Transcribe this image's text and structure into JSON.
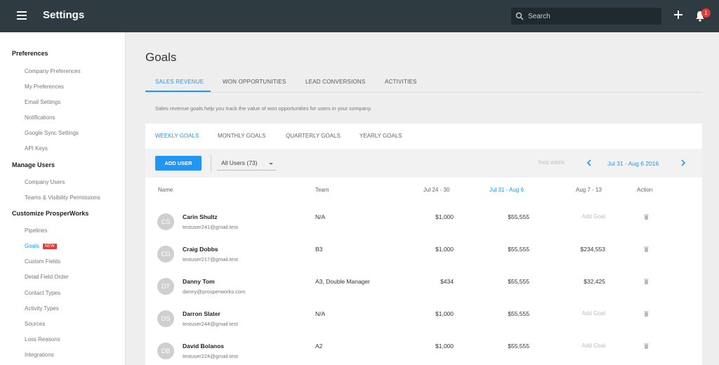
{
  "app": {
    "title": "Settings"
  },
  "search": {
    "placeholder": "Search"
  },
  "notifications": {
    "count": "1"
  },
  "sidebar": {
    "sections": [
      {
        "title": "Preferences",
        "items": [
          "Company Preferences",
          "My Preferences",
          "Email Settings",
          "Notifications",
          "Google Sync Settings",
          "API Keys"
        ]
      },
      {
        "title": "Manage Users",
        "items": [
          "Company Users",
          "Teams & Visibility Permissions"
        ]
      },
      {
        "title": "Customize ProsperWorks",
        "items": [
          "Pipelines",
          "Goals",
          "Custom Fields",
          "Detail Field Order",
          "Contact Types",
          "Activity Types",
          "Sources",
          "Loss Reasons",
          "Integrations"
        ]
      }
    ],
    "active_item": "Goals",
    "new_badge": "NEW"
  },
  "page": {
    "title": "Goals",
    "tabs": [
      "SALES REVENUE",
      "WON OPPORTUNITIES",
      "LEAD CONVERSIONS",
      "ACTIVITIES"
    ],
    "active_tab": "SALES REVENUE",
    "description": "Sales revenue goals help you track the value of won opportunities for users in your company."
  },
  "goals": {
    "period_tabs": [
      "WEEKLY GOALS",
      "MONTHLY GOALS",
      "QUARTERLY GOALS",
      "YEARLY GOALS"
    ],
    "active_period": "WEEKLY GOALS",
    "add_user_label": "ADD USER",
    "user_filter": "All Users (73)",
    "this_week_label": "THIS WEEK",
    "date_range": "Jul 31 - Aug 6 2016",
    "columns": [
      "Name",
      "Team",
      "Jul 24 - 30",
      "Jul 31 - Aug 6",
      "Aug 7 - 13",
      "Action"
    ],
    "rows": [
      {
        "initials": "CS",
        "name": "Carin Shultz",
        "email": "testuser241@gmail.test",
        "team": "N/A",
        "prev": "$1,000",
        "current": "$55,555",
        "next": "Add Goal"
      },
      {
        "initials": "CD",
        "name": "Craig Dobbs",
        "email": "testuser217@gmail.test",
        "team": "B3",
        "prev": "$1,000",
        "current": "$55,555",
        "next": "$234,553"
      },
      {
        "initials": "DT",
        "name": "Danny Tom",
        "email": "danny@prosperworks.com",
        "team": "A3, Double Manager",
        "prev": "$434",
        "current": "$55,555",
        "next": "$32,425"
      },
      {
        "initials": "DS",
        "name": "Darron Slater",
        "email": "testuser244@gmail.test",
        "team": "N/A",
        "prev": "$1,000",
        "current": "$55,555",
        "next": "Add Goal"
      },
      {
        "initials": "DB",
        "name": "David Bolanos",
        "email": "testuser224@gmail.test",
        "team": "A2",
        "prev": "$1,000",
        "current": "$55,555",
        "next": "Add Goal"
      }
    ]
  },
  "colors": {
    "accent": "#2196f3",
    "topbar": "#2e3b40",
    "badge": "#e53935"
  }
}
